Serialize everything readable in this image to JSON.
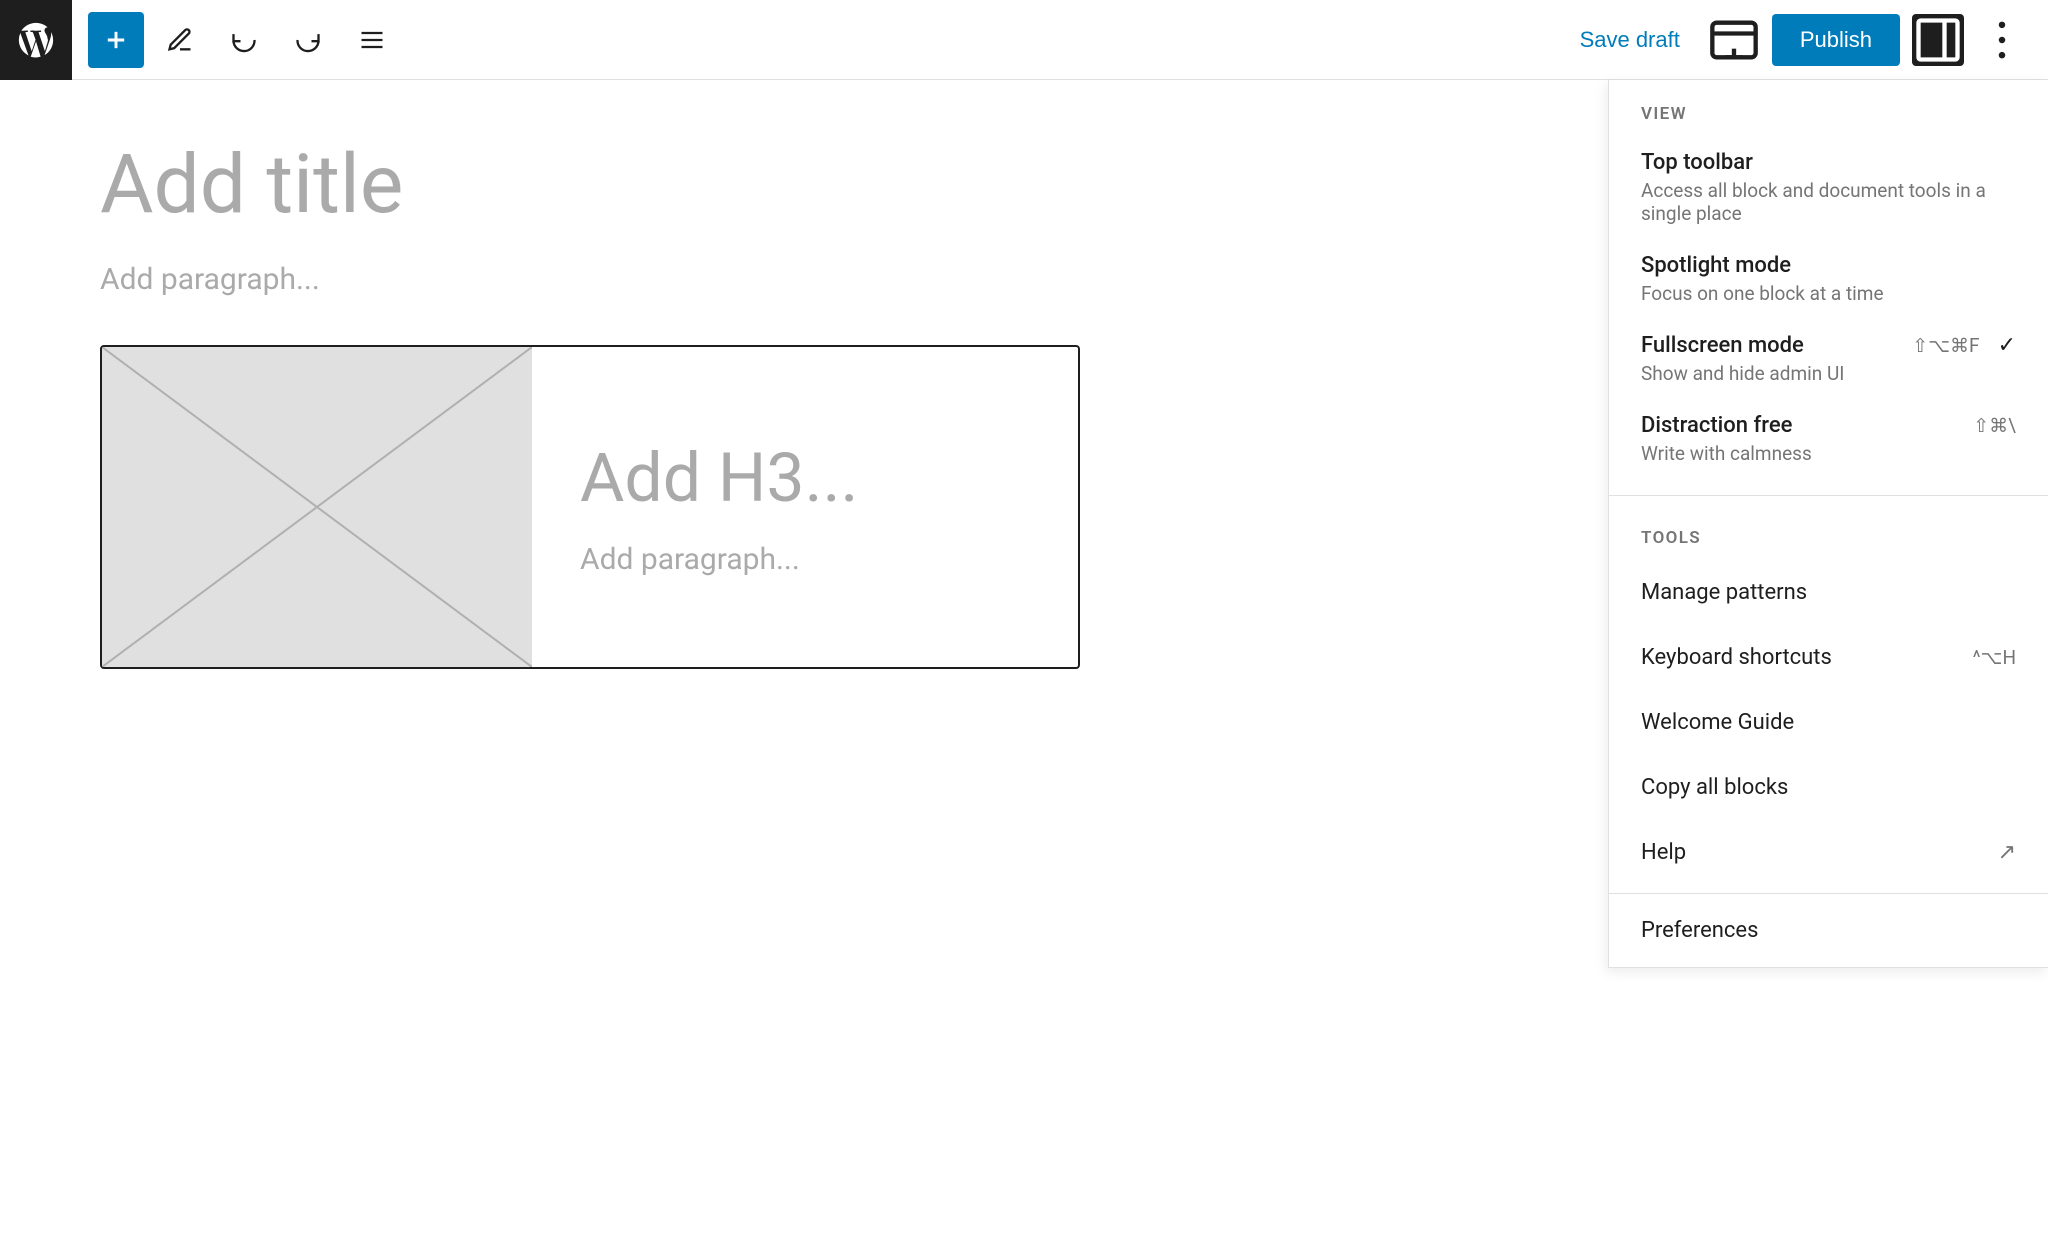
{
  "toolbar": {
    "add_label": "+",
    "save_draft_label": "Save draft",
    "publish_label": "Publish"
  },
  "editor": {
    "add_title_placeholder": "Add title",
    "add_paragraph_placeholder": "Add paragraph...",
    "block": {
      "add_h3_placeholder": "Add H3...",
      "add_paragraph_placeholder": "Add paragraph..."
    }
  },
  "dropdown": {
    "view_section_title": "VIEW",
    "top_toolbar_title": "Top toolbar",
    "top_toolbar_desc": "Access all block and document tools in a single place",
    "spotlight_mode_title": "Spotlight mode",
    "spotlight_desc": "Focus on one block at a time",
    "fullscreen_mode_title": "Fullscreen mode",
    "fullscreen_desc": "Show and hide admin UI",
    "fullscreen_shortcut": "⇧⌥⌘F",
    "fullscreen_check": "✓",
    "distraction_free_title": "Distraction free",
    "distraction_free_desc": "Write with calmness",
    "distraction_free_shortcut": "⇧⌘\\",
    "tools_section_title": "TOOLS",
    "manage_patterns_label": "Manage patterns",
    "keyboard_shortcuts_label": "Keyboard shortcuts",
    "keyboard_shortcuts_shortcut": "^⌥H",
    "welcome_guide_label": "Welcome Guide",
    "copy_all_blocks_label": "Copy all blocks",
    "help_label": "Help",
    "preferences_label": "Preferences"
  }
}
